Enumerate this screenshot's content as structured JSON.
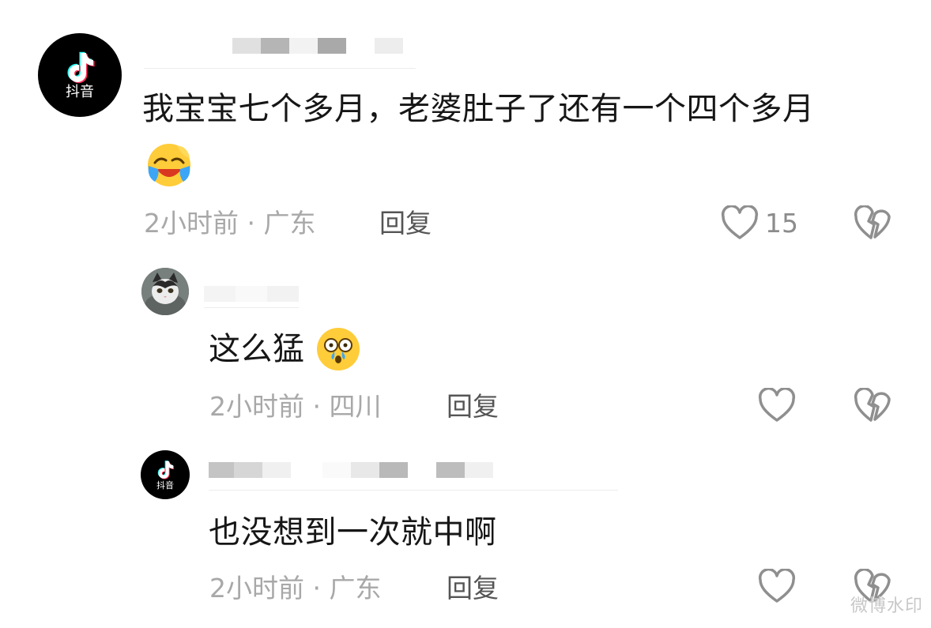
{
  "app": {
    "logo_text": "抖音",
    "watermark": "微博水印"
  },
  "comments": [
    {
      "text": "我宝宝七个多月，老婆肚子了还有一个四个多月",
      "emoji": "laughing-crying-emoji",
      "meta": "2小时前 · 广东",
      "reply_label": "回复",
      "like_count": "15",
      "avatar": "douyin-logo-avatar"
    },
    {
      "text": "这么猛",
      "emoji": "shocked-emoji",
      "meta": "2小时前 · 四川",
      "reply_label": "回复",
      "like_count": "",
      "avatar": "cat-photo-avatar"
    },
    {
      "text": "也没想到一次就中啊",
      "meta": "2小时前 · 广东",
      "reply_label": "回复",
      "like_count": "",
      "avatar": "douyin-logo-avatar"
    }
  ],
  "icons": {
    "like": "heart-outline-icon",
    "dislike": "broken-heart-icon"
  },
  "colors": {
    "text": "#161616",
    "meta": "#a8a8a8",
    "reply": "#555555",
    "icon": "#8f8f8f"
  }
}
